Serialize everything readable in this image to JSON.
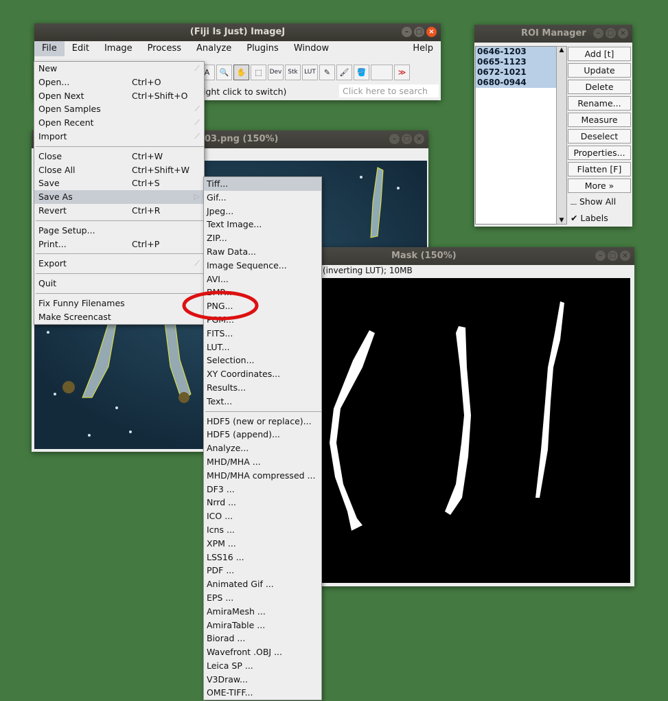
{
  "imagej": {
    "title": "(Fiji Is Just) ImageJ",
    "menus": [
      "File",
      "Edit",
      "Image",
      "Process",
      "Analyze",
      "Plugins",
      "Window",
      "Help"
    ],
    "tools": [
      "A",
      "🔍",
      "✋",
      "⬚",
      "Dev",
      "Stk",
      "LUT",
      "✎",
      "🖌",
      "🪣",
      "≫"
    ],
    "status": "ight click to switch)",
    "search_placeholder": "Click here to search"
  },
  "file_menu": [
    {
      "label": "New",
      "shortcut": "",
      "sub": true
    },
    {
      "label": "Open...",
      "shortcut": "Ctrl+O"
    },
    {
      "label": "Open Next",
      "shortcut": "Ctrl+Shift+O"
    },
    {
      "label": "Open Samples",
      "shortcut": "",
      "sub": true
    },
    {
      "label": "Open Recent",
      "shortcut": "",
      "sub": true
    },
    {
      "label": "Import",
      "shortcut": "",
      "sub": true
    },
    {
      "sep": true
    },
    {
      "label": "Close",
      "shortcut": "Ctrl+W"
    },
    {
      "label": "Close All",
      "shortcut": "Ctrl+Shift+W"
    },
    {
      "label": "Save",
      "shortcut": "Ctrl+S"
    },
    {
      "label": "Save As",
      "shortcut": "",
      "sub": true,
      "highlight": true
    },
    {
      "label": "Revert",
      "shortcut": "Ctrl+R"
    },
    {
      "sep": true
    },
    {
      "label": "Page Setup...",
      "shortcut": ""
    },
    {
      "label": "Print...",
      "shortcut": "Ctrl+P"
    },
    {
      "sep": true
    },
    {
      "label": "Export",
      "shortcut": "",
      "sub": true
    },
    {
      "sep": true
    },
    {
      "label": "Quit",
      "shortcut": ""
    },
    {
      "sep": true
    },
    {
      "label": "Fix Funny Filenames",
      "shortcut": ""
    },
    {
      "label": "Make Screencast",
      "shortcut": ""
    }
  ],
  "save_as_menu": [
    "Tiff...",
    "Gif...",
    "Jpeg...",
    "Text Image...",
    "ZIP...",
    "Raw Data...",
    "Image Sequence...",
    "AVI...",
    "BMP...",
    "PNG...",
    "PGM...",
    "FITS...",
    "LUT...",
    "Selection...",
    "XY Coordinates...",
    "Results...",
    "Text...",
    "---",
    "HDF5 (new or replace)...",
    "HDF5 (append)...",
    "Analyze...",
    "MHD/MHA ...",
    "MHD/MHA compressed ...",
    "DF3 ...",
    "Nrrd ...",
    "ICO ...",
    "Icns ...",
    "XPM ...",
    "LSS16 ...",
    "PDF ...",
    "Animated Gif ...",
    "EPS ...",
    "AmiraMesh ...",
    "AmiraTable ...",
    "Biorad ...",
    "Wavefront .OBJ ...",
    "Leica SP ...",
    "V3Draw...",
    "OME-TIFF..."
  ],
  "image_window": {
    "title": "03.png (150%)"
  },
  "mask_window": {
    "title": "Mask (150%)",
    "info": "(inverting LUT); 10MB"
  },
  "roi_manager": {
    "title": "ROI Manager",
    "items": [
      "0646-1203",
      "0665-1123",
      "0672-1021",
      "0680-0944"
    ],
    "buttons": [
      "Add [t]",
      "Update",
      "Delete",
      "Rename...",
      "Measure",
      "Deselect",
      "Properties...",
      "Flatten [F]",
      "More »"
    ],
    "show_all_label": "Show All",
    "labels_label": "Labels"
  },
  "annotation_color": "#dd1111"
}
